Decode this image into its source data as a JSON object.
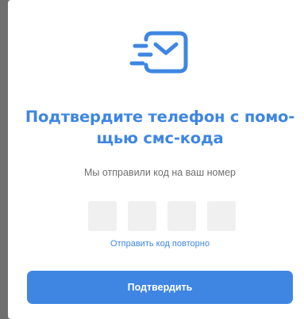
{
  "modal": {
    "icon": "envelope-fast-icon",
    "title": "Подтвердите телефон с помо-щью смс-кода",
    "title_line1": "Подтвердите телефон с помо-",
    "title_line2": "щью смс-кода",
    "subtitle": "Мы отправили код на ваш номер",
    "code_digits": [
      "",
      "",
      "",
      ""
    ],
    "resend_label": "Отправить код повторно",
    "confirm_label": "Подтвердить"
  },
  "colors": {
    "accent": "#3f86e3",
    "backdrop": "#7d7d7d",
    "input_bg": "#f0f0f0",
    "muted_text": "#6f6f6f"
  }
}
